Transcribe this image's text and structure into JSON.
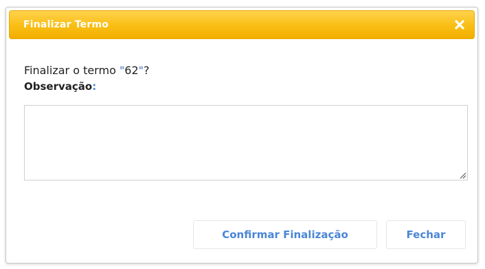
{
  "dialog": {
    "title": "Finalizar Termo",
    "question_prefix": "Finalizar o termo ",
    "term_quote_open": "\"",
    "term_id": "62",
    "term_quote_close": "\"",
    "question_suffix": "?",
    "observation_label": "Observação",
    "observation_colon": ":",
    "observation_value": "",
    "buttons": {
      "confirm_label": "Confirmar Finalização",
      "close_label": "Fechar"
    }
  },
  "colors": {
    "titlebar": "#f9be13",
    "title_text": "#ffffff",
    "button_text": "#4a86d6"
  },
  "icons": {
    "close": "close-icon",
    "resize": "resize-grip-icon"
  }
}
